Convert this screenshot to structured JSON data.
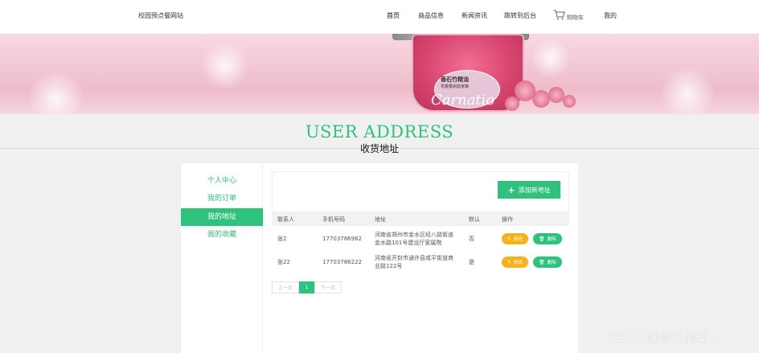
{
  "header": {
    "brand": "校园预点餐网站",
    "nav": [
      {
        "label": "首页"
      },
      {
        "label": "商品信息"
      },
      {
        "label": "新闻资讯"
      },
      {
        "label": "跳转到后台"
      }
    ],
    "cart_label": "购物车",
    "my_label": "我的"
  },
  "banner": {
    "product_title": "香石竹精油",
    "product_subtitle": "花瓣香启能家蔬",
    "product_script": "Carnatio"
  },
  "page": {
    "title_en": "USER ADDRESS",
    "title_cn": "收货地址"
  },
  "sidebar": {
    "items": [
      {
        "label": "个人中心",
        "active": false
      },
      {
        "label": "我的订单",
        "active": false
      },
      {
        "label": "我的地址",
        "active": true
      },
      {
        "label": "我的收藏",
        "active": false
      }
    ]
  },
  "toolbar": {
    "add_label": "添加新地址"
  },
  "table": {
    "headers": [
      "联系人",
      "手机号码",
      "地址",
      "默认",
      "操作"
    ],
    "rows": [
      {
        "name": "张2",
        "phone": "17703786962",
        "address": "河南省郑州市金水区经八路街道金水路101号建设厅家属院",
        "default": "否"
      },
      {
        "name": "张22",
        "phone": "17703786222",
        "address": "河南省开封市通许县咸平街道商业路122号",
        "default": "是"
      }
    ],
    "edit_label": "修改",
    "delete_label": "删除"
  },
  "pager": {
    "prev": "上一页",
    "current": "1",
    "next": "下一页"
  },
  "watermark": "CSDN @曾几何时…",
  "colors": {
    "accent": "#2fc27c",
    "edit": "#f5b21b"
  }
}
